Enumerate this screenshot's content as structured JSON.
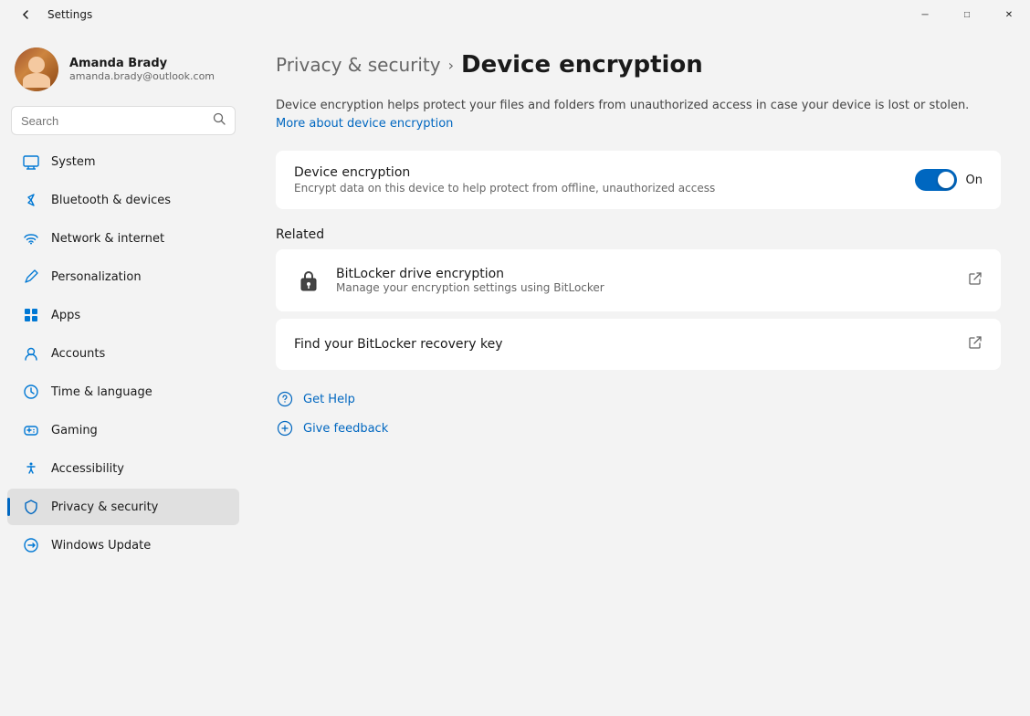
{
  "titlebar": {
    "title": "Settings",
    "back_icon": "←",
    "minimize_icon": "─",
    "maximize_icon": "□",
    "close_icon": "✕"
  },
  "user": {
    "name": "Amanda Brady",
    "email": "amanda.brady@outlook.com"
  },
  "search": {
    "placeholder": "Search"
  },
  "nav": {
    "items": [
      {
        "id": "system",
        "label": "System",
        "color": "#0078d4"
      },
      {
        "id": "bluetooth",
        "label": "Bluetooth & devices",
        "color": "#0078d4"
      },
      {
        "id": "network",
        "label": "Network & internet",
        "color": "#0078d4"
      },
      {
        "id": "personalization",
        "label": "Personalization",
        "color": "#0078d4"
      },
      {
        "id": "apps",
        "label": "Apps",
        "color": "#0078d4"
      },
      {
        "id": "accounts",
        "label": "Accounts",
        "color": "#0078d4"
      },
      {
        "id": "time",
        "label": "Time & language",
        "color": "#0078d4"
      },
      {
        "id": "gaming",
        "label": "Gaming",
        "color": "#0078d4"
      },
      {
        "id": "accessibility",
        "label": "Accessibility",
        "color": "#0078d4"
      },
      {
        "id": "privacy",
        "label": "Privacy & security",
        "color": "#0078d4",
        "active": true
      },
      {
        "id": "update",
        "label": "Windows Update",
        "color": "#0078d4"
      }
    ]
  },
  "page": {
    "breadcrumb_parent": "Privacy & security",
    "breadcrumb_separator": "›",
    "breadcrumb_current": "Device encryption",
    "description": "Device encryption helps protect your files and folders from unauthorized access in case your device is lost or stolen.",
    "description_link_text": "More about device encryption",
    "main_setting": {
      "title": "Device encryption",
      "description": "Encrypt data on this device to help protect from offline, unauthorized access",
      "toggle_state": "On",
      "toggle_on": true
    },
    "related": {
      "label": "Related",
      "items": [
        {
          "title": "BitLocker drive encryption",
          "subtitle": "Manage your encryption settings using BitLocker",
          "has_icon": true
        },
        {
          "title": "Find your BitLocker recovery key",
          "has_icon": false
        }
      ]
    },
    "help": {
      "get_help_label": "Get Help",
      "give_feedback_label": "Give feedback"
    }
  }
}
